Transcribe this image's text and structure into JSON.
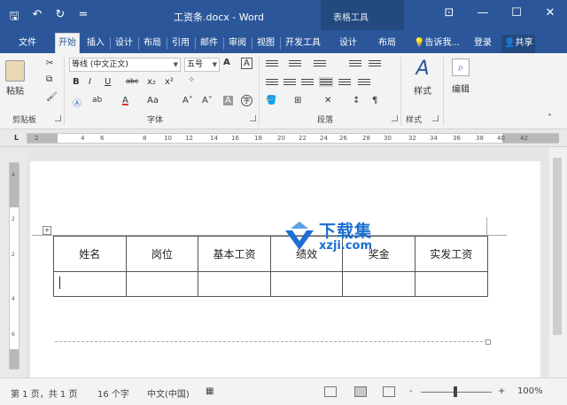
{
  "window": {
    "title": "工资条.docx - Word",
    "context_tab_title": "表格工具",
    "qat": {
      "save_glyph": "🖫",
      "undo_glyph": "↶",
      "redo_glyph": "↻",
      "customize_glyph": "="
    },
    "controls": {
      "ribbon_display": "⊡",
      "minimize": "—",
      "maximize": "☐",
      "close": "✕"
    }
  },
  "tabs": [
    {
      "label": "文件"
    },
    {
      "label": "开始"
    },
    {
      "label": "插入"
    },
    {
      "label": "设计"
    },
    {
      "label": "布局"
    },
    {
      "label": "引用"
    },
    {
      "label": "邮件"
    },
    {
      "label": "审阅"
    },
    {
      "label": "视图"
    },
    {
      "label": "开发工具"
    },
    {
      "label": "设计"
    },
    {
      "label": "布局"
    }
  ],
  "tell_me": "告诉我...",
  "signin": "登录",
  "share": "共享",
  "ribbon": {
    "clipboard": {
      "paste": "粘贴",
      "label": "剪贴板"
    },
    "font": {
      "label": "字体",
      "font_name": "等线 (中文正文)",
      "font_size": "五号",
      "bold": "B",
      "italic": "I",
      "underline": "U",
      "strike": "abc",
      "sub": "x₂",
      "sup": "x²",
      "grow": "A˄",
      "shrink": "A˅",
      "aa": "Aa",
      "font_color": "A",
      "highlight": "ab",
      "charshade": "A",
      "enclose": "字"
    },
    "paragraph": {
      "label": "段落"
    },
    "styles": {
      "styles": "样式",
      "label": "样式"
    },
    "editing": {
      "edit": "编辑"
    }
  },
  "ruler": {
    "marks": [
      "2",
      "2",
      "4",
      "6",
      "8",
      "10",
      "12",
      "14",
      "16",
      "18",
      "20",
      "22",
      "24",
      "26",
      "28",
      "30",
      "32",
      "34",
      "36",
      "38",
      "40",
      "42"
    ],
    "vmarks": [
      "4",
      "2",
      "2",
      "4",
      "6"
    ]
  },
  "table": {
    "headers": [
      "姓名",
      "岗位",
      "基本工资",
      "绩效",
      "奖金",
      "实发工资"
    ],
    "rows": [
      [
        "",
        "",
        "",
        "",
        "",
        ""
      ]
    ]
  },
  "watermark": {
    "text": "下载集",
    "url": "xzji.com"
  },
  "status": {
    "page": "第 1 页，共 1 页",
    "words": "16 个字",
    "language": "中文(中国)",
    "zoom": "100%",
    "zoom_minus": "-",
    "zoom_plus": "+"
  },
  "colors": {
    "accent": "#2b579a",
    "watermark": "#1c6fd1"
  }
}
